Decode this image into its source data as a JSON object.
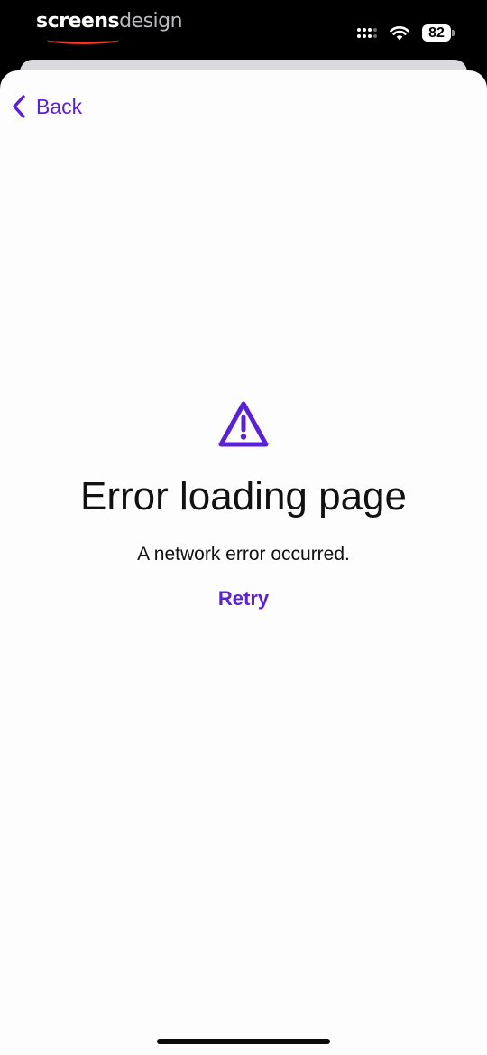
{
  "status_bar": {
    "brand_part1": "screens",
    "brand_part2": "design",
    "battery_level": "82",
    "icons": [
      "signal-icon",
      "wifi-icon",
      "battery-icon"
    ]
  },
  "nav": {
    "back_label": "Back",
    "back_icon": "chevron-left-icon"
  },
  "error": {
    "icon": "warning-triangle-icon",
    "title": "Error loading page",
    "message": "A network error occurred.",
    "retry_label": "Retry"
  },
  "colors": {
    "accent": "#5b21d6",
    "text": "#111111",
    "background": "#fdfdfd",
    "brand_underline": "#e0402c"
  }
}
